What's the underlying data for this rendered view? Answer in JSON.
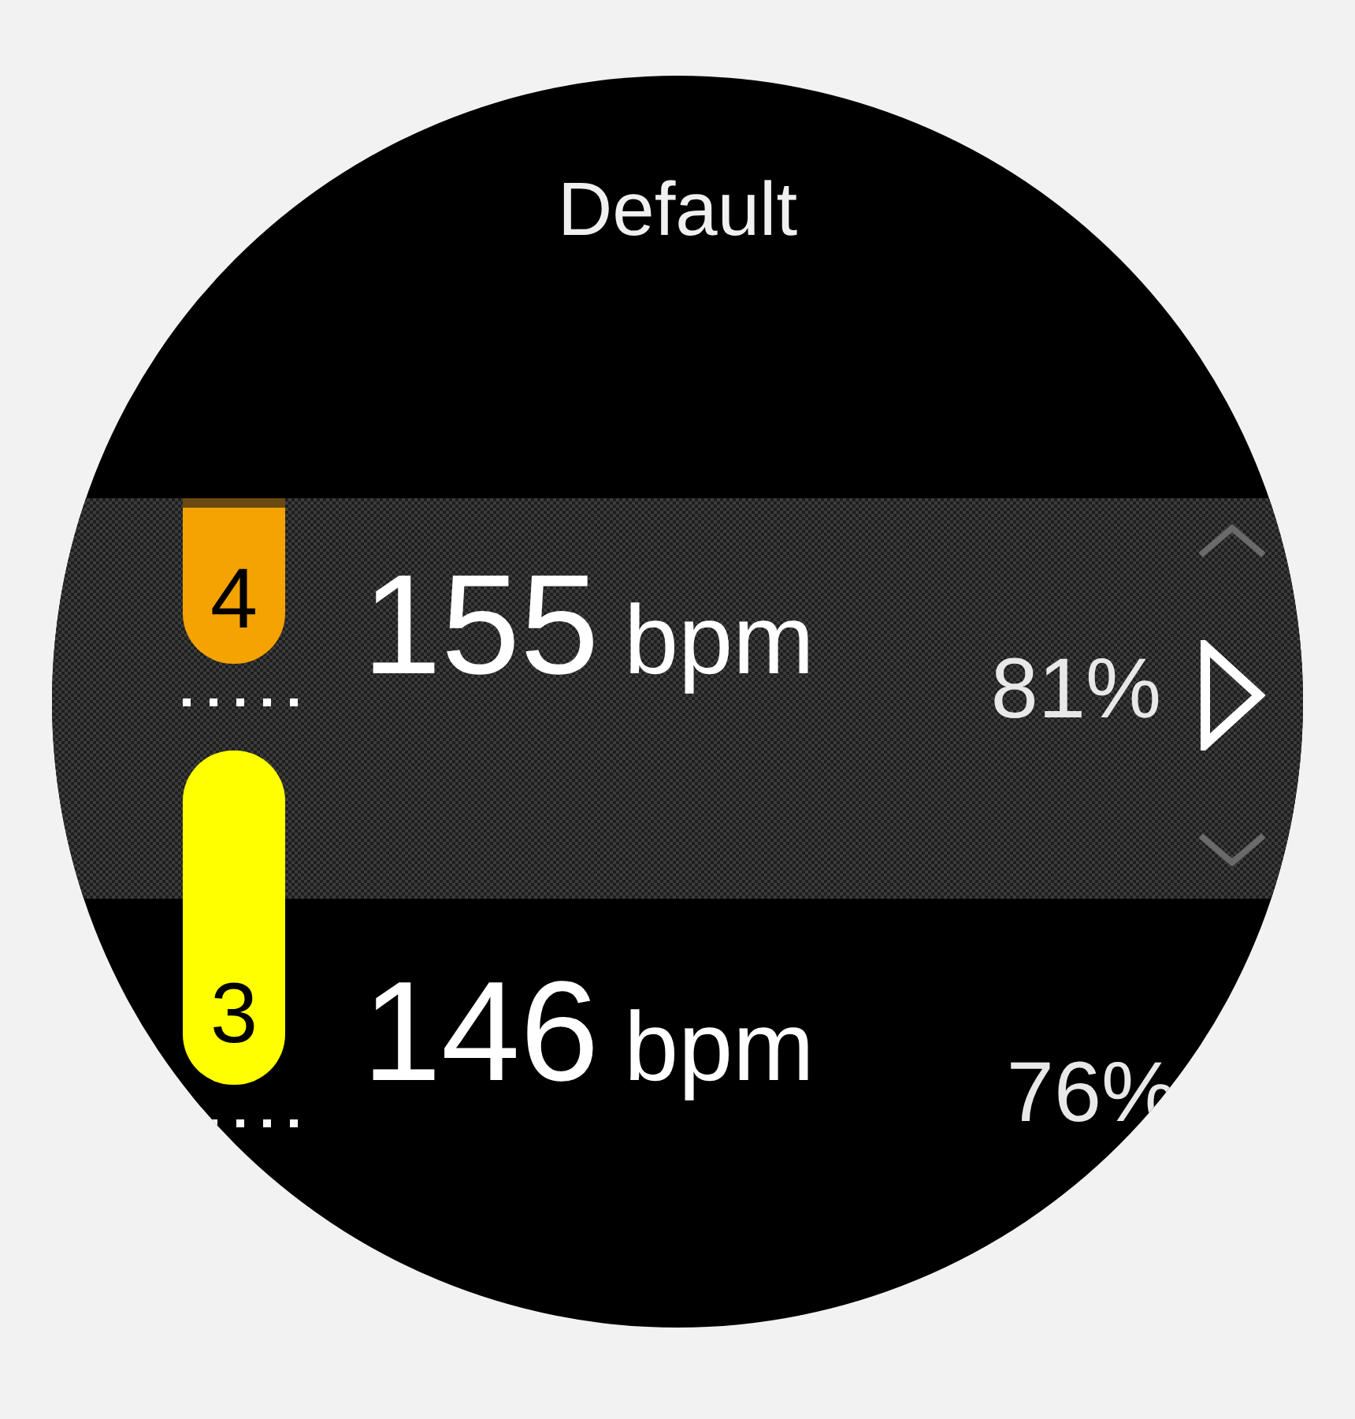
{
  "title": "Default",
  "zones": [
    {
      "zone": "4",
      "color": "#f5a300",
      "reading": "155",
      "unit": "bpm",
      "percent": "81%",
      "selected": true
    },
    {
      "zone": "3",
      "color": "#ffff00",
      "reading": "146",
      "unit": "bpm",
      "percent": "76%",
      "selected": false
    }
  ]
}
